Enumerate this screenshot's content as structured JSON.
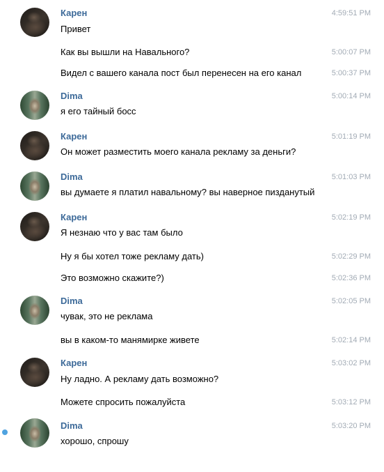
{
  "colors": {
    "sender_name": "#3d6a99",
    "timestamp": "#a2abb5",
    "unread_indicator": "#4fa3e0",
    "background": "#ffffff"
  },
  "groups": [
    {
      "sender": "Карен",
      "avatar": "karen",
      "messages": [
        {
          "text": "Привет",
          "time": "4:59:51 PM"
        },
        {
          "text": "Как вы вышли на Навального?",
          "time": "5:00:07 PM"
        },
        {
          "text": "Видел с вашего канала пост был перенесен на его канал",
          "time": "5:00:37 PM"
        }
      ]
    },
    {
      "sender": "Dima",
      "avatar": "dima",
      "messages": [
        {
          "text": "я его тайный босс",
          "time": "5:00:14 PM"
        }
      ]
    },
    {
      "sender": "Карен",
      "avatar": "karen",
      "messages": [
        {
          "text": "Он может разместить моего канала рекламу за деньги?",
          "time": "5:01:19 PM"
        }
      ]
    },
    {
      "sender": "Dima",
      "avatar": "dima",
      "messages": [
        {
          "text": "вы думаете я платил навальному? вы наверное пизданутый",
          "time": "5:01:03 PM"
        }
      ]
    },
    {
      "sender": "Карен",
      "avatar": "karen",
      "messages": [
        {
          "text": "Я незнаю что у вас там было",
          "time": "5:02:19 PM"
        },
        {
          "text": "Ну я бы хотел тоже рекламу дать)",
          "time": "5:02:29 PM"
        },
        {
          "text": "Это возможно скажите?)",
          "time": "5:02:36 PM"
        }
      ]
    },
    {
      "sender": "Dima",
      "avatar": "dima",
      "messages": [
        {
          "text": "чувак, это не реклама",
          "time": "5:02:05 PM"
        },
        {
          "text": "вы в каком-то манямирке живете",
          "time": "5:02:14 PM"
        }
      ]
    },
    {
      "sender": "Карен",
      "avatar": "karen",
      "messages": [
        {
          "text": "Ну ладно. А рекламу дать возможно?",
          "time": "5:03:02 PM"
        },
        {
          "text": "Можете спросить пожалуйста",
          "time": "5:03:12 PM"
        }
      ]
    },
    {
      "sender": "Dima",
      "avatar": "dima",
      "messages": [
        {
          "text": "хорошо, спрошу",
          "time": "5:03:20 PM"
        }
      ]
    }
  ]
}
